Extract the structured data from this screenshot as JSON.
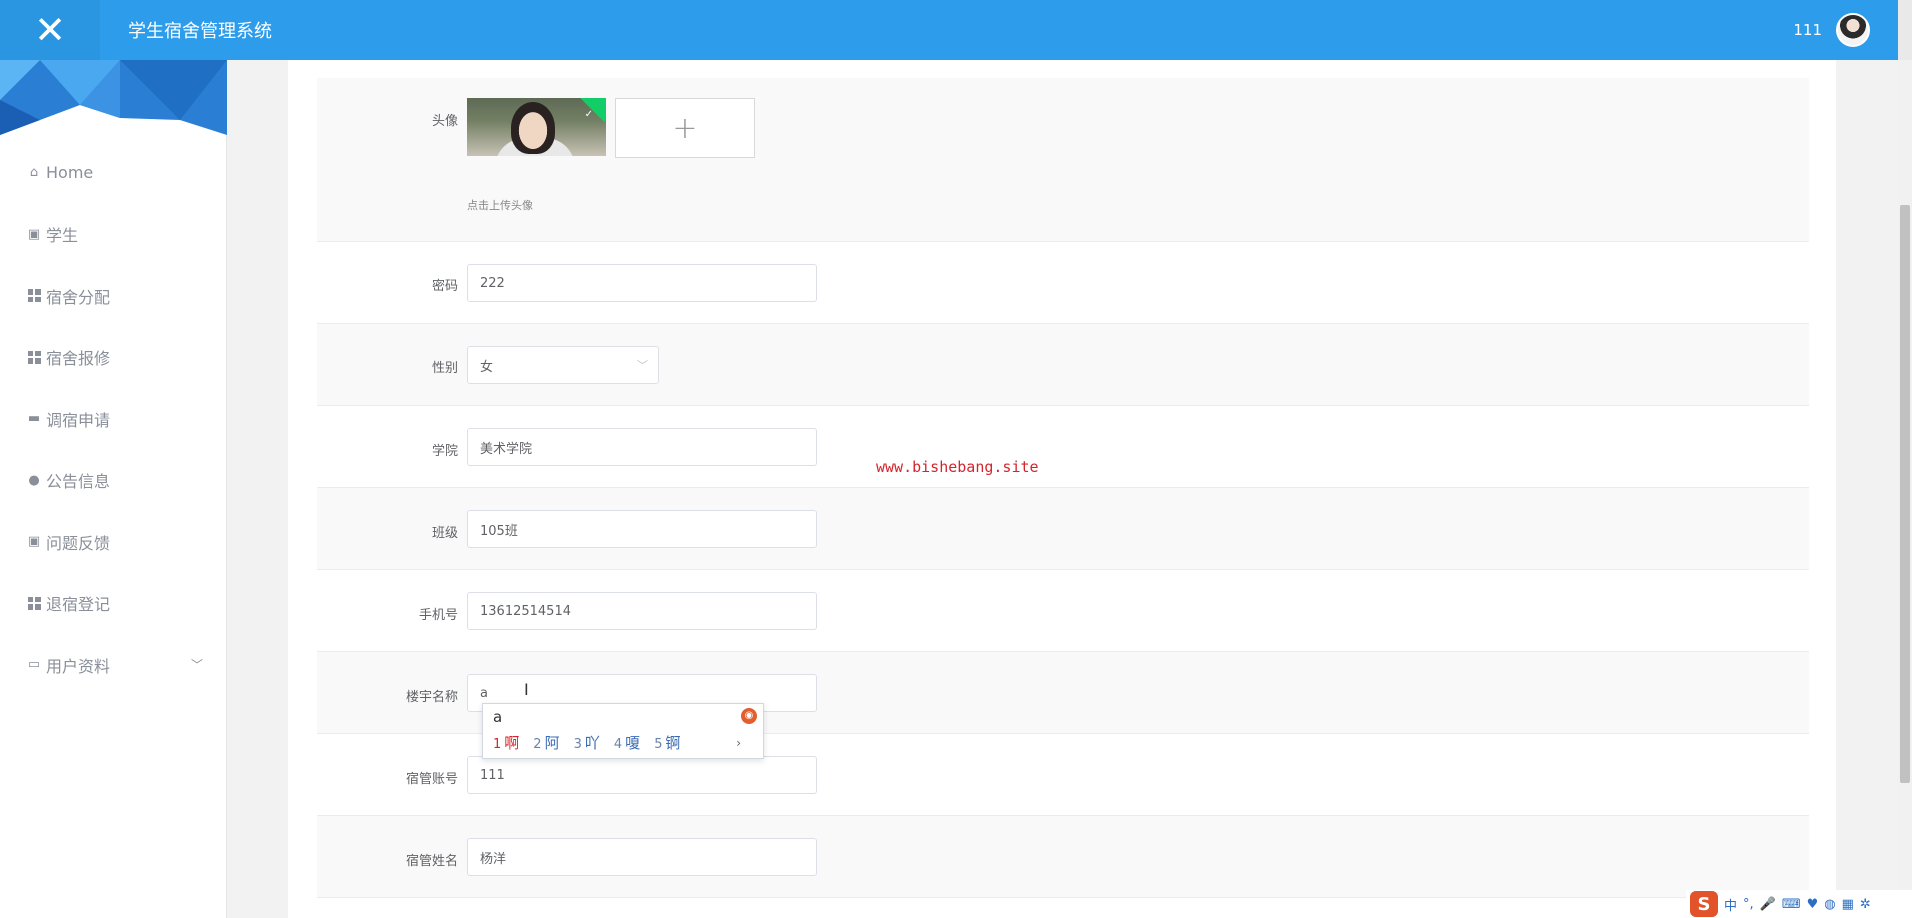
{
  "header": {
    "close_icon": "✕",
    "title": "学生宿舍管理系统",
    "username": "111"
  },
  "sidebar": {
    "items": [
      {
        "label": "Home",
        "icon": "home-icon"
      },
      {
        "label": "学生",
        "icon": "clipboard-icon"
      },
      {
        "label": "宿舍分配",
        "icon": "grid-icon"
      },
      {
        "label": "宿舍报修",
        "icon": "grid-icon"
      },
      {
        "label": "调宿申请",
        "icon": "comment-icon"
      },
      {
        "label": "公告信息",
        "icon": "user-icon"
      },
      {
        "label": "问题反馈",
        "icon": "clipboard-x-icon"
      },
      {
        "label": "退宿登记",
        "icon": "grid-icon"
      },
      {
        "label": "用户资料",
        "icon": "card-icon"
      }
    ]
  },
  "form": {
    "avatar": {
      "label": "头像",
      "add_icon": "+",
      "hint": "点击上传头像"
    },
    "password": {
      "label": "密码",
      "value": "222"
    },
    "gender": {
      "label": "性别",
      "value": "女"
    },
    "college": {
      "label": "学院",
      "value": "美术学院"
    },
    "class": {
      "label": "班级",
      "value": "105班"
    },
    "phone": {
      "label": "手机号",
      "value": "13612514514"
    },
    "building": {
      "label": "楼宇名称",
      "value": "a"
    },
    "manager_account": {
      "label": "宿管账号",
      "value": "111"
    },
    "manager_name": {
      "label": "宿管姓名",
      "value": "杨洋"
    }
  },
  "watermark": "www.bishebang.site",
  "ime": {
    "composition": "a",
    "candidates": [
      {
        "n": "1",
        "text": "啊"
      },
      {
        "n": "2",
        "text": "阿"
      },
      {
        "n": "3",
        "text": "吖"
      },
      {
        "n": "4",
        "text": "嗄"
      },
      {
        "n": "5",
        "text": "锕"
      }
    ],
    "more": "›"
  },
  "tray": {
    "logo": "S",
    "lang": "中",
    "punct": "°,"
  },
  "colors": {
    "header_bg": "#2d9cea",
    "watermark": "#d4252d"
  }
}
